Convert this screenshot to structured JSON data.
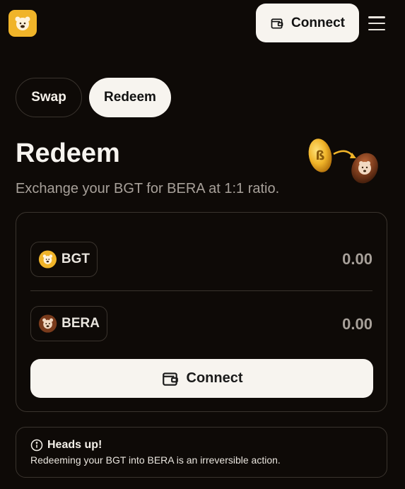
{
  "header": {
    "connect_label": "Connect",
    "logo_icon": "bear-logo-icon",
    "menu_icon": "hamburger-menu-icon"
  },
  "tabs": [
    {
      "label": "Swap",
      "active": false
    },
    {
      "label": "Redeem",
      "active": true
    }
  ],
  "main": {
    "title": "Redeem",
    "subtitle": "Exchange your BGT for BERA at 1:1 ratio."
  },
  "form": {
    "from": {
      "symbol": "BGT",
      "amount": "0.00",
      "icon": "bgt-token-icon"
    },
    "to": {
      "symbol": "BERA",
      "amount": "0.00",
      "icon": "bera-token-icon"
    },
    "connect_label": "Connect"
  },
  "notice": {
    "title": "Heads up!",
    "body": "Redeeming your BGT into BERA is an irreversible action."
  },
  "colors": {
    "background": "#0e0a07",
    "accent_gold": "#f0b429",
    "bera_brown": "#7a3b1c",
    "button_light": "#f7f4ef"
  }
}
